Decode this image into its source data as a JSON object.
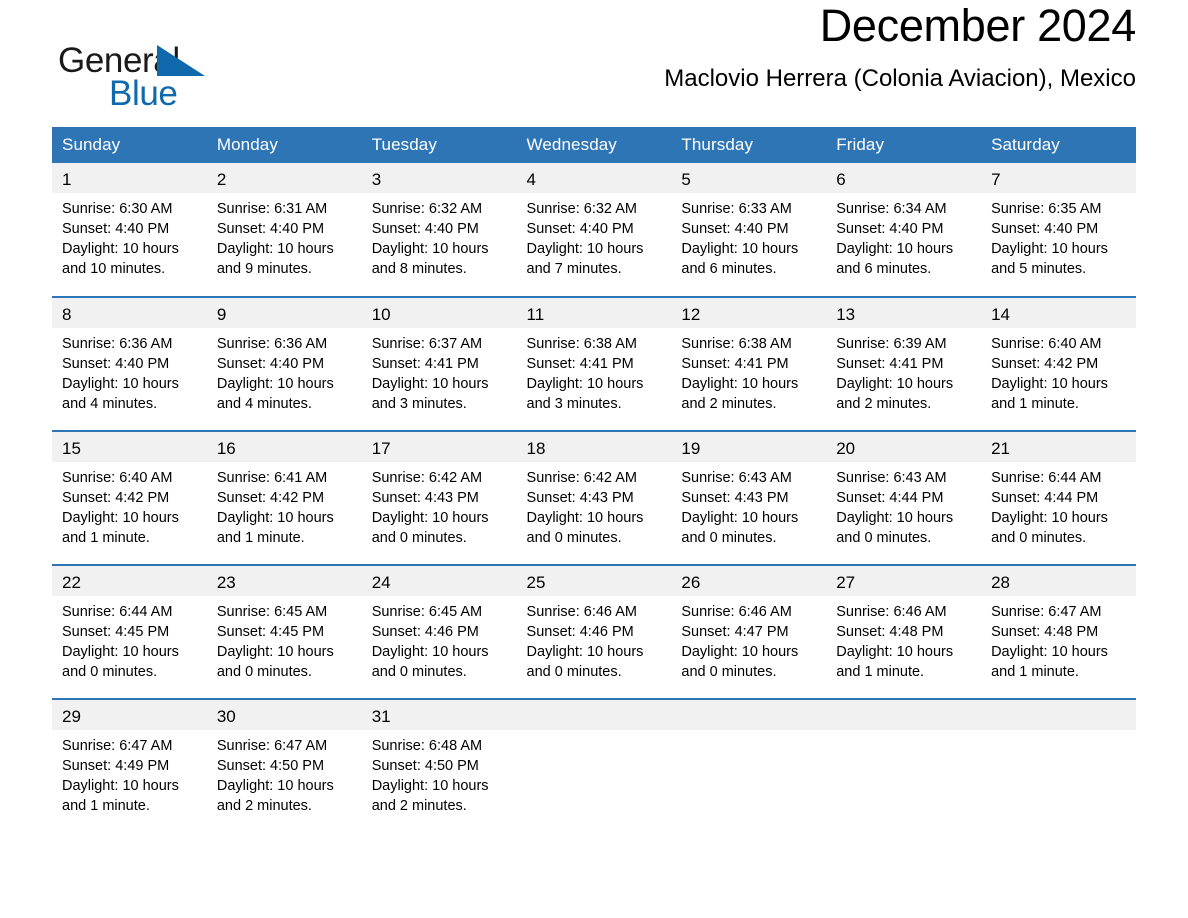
{
  "brand": {
    "name_part1": "General",
    "name_part2": "Blue",
    "triangle_color": "#1069ad",
    "icon": "brand-triangle-icon"
  },
  "header": {
    "month_title": "December 2024",
    "location": "Maclovio Herrera (Colonia Aviacion), Mexico"
  },
  "theme": {
    "header_blue": "#2e75b6",
    "daynum_band_gray": "#f1f1f1",
    "row_separator_blue": "#2e75b6",
    "text_black": "#000000"
  },
  "weekday_headers": [
    "Sunday",
    "Monday",
    "Tuesday",
    "Wednesday",
    "Thursday",
    "Friday",
    "Saturday"
  ],
  "weeks": [
    [
      {
        "day": "1",
        "sunrise": "Sunrise: 6:30 AM",
        "sunset": "Sunset: 4:40 PM",
        "daylight_l1": "Daylight: 10 hours",
        "daylight_l2": "and 10 minutes."
      },
      {
        "day": "2",
        "sunrise": "Sunrise: 6:31 AM",
        "sunset": "Sunset: 4:40 PM",
        "daylight_l1": "Daylight: 10 hours",
        "daylight_l2": "and 9 minutes."
      },
      {
        "day": "3",
        "sunrise": "Sunrise: 6:32 AM",
        "sunset": "Sunset: 4:40 PM",
        "daylight_l1": "Daylight: 10 hours",
        "daylight_l2": "and 8 minutes."
      },
      {
        "day": "4",
        "sunrise": "Sunrise: 6:32 AM",
        "sunset": "Sunset: 4:40 PM",
        "daylight_l1": "Daylight: 10 hours",
        "daylight_l2": "and 7 minutes."
      },
      {
        "day": "5",
        "sunrise": "Sunrise: 6:33 AM",
        "sunset": "Sunset: 4:40 PM",
        "daylight_l1": "Daylight: 10 hours",
        "daylight_l2": "and 6 minutes."
      },
      {
        "day": "6",
        "sunrise": "Sunrise: 6:34 AM",
        "sunset": "Sunset: 4:40 PM",
        "daylight_l1": "Daylight: 10 hours",
        "daylight_l2": "and 6 minutes."
      },
      {
        "day": "7",
        "sunrise": "Sunrise: 6:35 AM",
        "sunset": "Sunset: 4:40 PM",
        "daylight_l1": "Daylight: 10 hours",
        "daylight_l2": "and 5 minutes."
      }
    ],
    [
      {
        "day": "8",
        "sunrise": "Sunrise: 6:36 AM",
        "sunset": "Sunset: 4:40 PM",
        "daylight_l1": "Daylight: 10 hours",
        "daylight_l2": "and 4 minutes."
      },
      {
        "day": "9",
        "sunrise": "Sunrise: 6:36 AM",
        "sunset": "Sunset: 4:40 PM",
        "daylight_l1": "Daylight: 10 hours",
        "daylight_l2": "and 4 minutes."
      },
      {
        "day": "10",
        "sunrise": "Sunrise: 6:37 AM",
        "sunset": "Sunset: 4:41 PM",
        "daylight_l1": "Daylight: 10 hours",
        "daylight_l2": "and 3 minutes."
      },
      {
        "day": "11",
        "sunrise": "Sunrise: 6:38 AM",
        "sunset": "Sunset: 4:41 PM",
        "daylight_l1": "Daylight: 10 hours",
        "daylight_l2": "and 3 minutes."
      },
      {
        "day": "12",
        "sunrise": "Sunrise: 6:38 AM",
        "sunset": "Sunset: 4:41 PM",
        "daylight_l1": "Daylight: 10 hours",
        "daylight_l2": "and 2 minutes."
      },
      {
        "day": "13",
        "sunrise": "Sunrise: 6:39 AM",
        "sunset": "Sunset: 4:41 PM",
        "daylight_l1": "Daylight: 10 hours",
        "daylight_l2": "and 2 minutes."
      },
      {
        "day": "14",
        "sunrise": "Sunrise: 6:40 AM",
        "sunset": "Sunset: 4:42 PM",
        "daylight_l1": "Daylight: 10 hours",
        "daylight_l2": "and 1 minute."
      }
    ],
    [
      {
        "day": "15",
        "sunrise": "Sunrise: 6:40 AM",
        "sunset": "Sunset: 4:42 PM",
        "daylight_l1": "Daylight: 10 hours",
        "daylight_l2": "and 1 minute."
      },
      {
        "day": "16",
        "sunrise": "Sunrise: 6:41 AM",
        "sunset": "Sunset: 4:42 PM",
        "daylight_l1": "Daylight: 10 hours",
        "daylight_l2": "and 1 minute."
      },
      {
        "day": "17",
        "sunrise": "Sunrise: 6:42 AM",
        "sunset": "Sunset: 4:43 PM",
        "daylight_l1": "Daylight: 10 hours",
        "daylight_l2": "and 0 minutes."
      },
      {
        "day": "18",
        "sunrise": "Sunrise: 6:42 AM",
        "sunset": "Sunset: 4:43 PM",
        "daylight_l1": "Daylight: 10 hours",
        "daylight_l2": "and 0 minutes."
      },
      {
        "day": "19",
        "sunrise": "Sunrise: 6:43 AM",
        "sunset": "Sunset: 4:43 PM",
        "daylight_l1": "Daylight: 10 hours",
        "daylight_l2": "and 0 minutes."
      },
      {
        "day": "20",
        "sunrise": "Sunrise: 6:43 AM",
        "sunset": "Sunset: 4:44 PM",
        "daylight_l1": "Daylight: 10 hours",
        "daylight_l2": "and 0 minutes."
      },
      {
        "day": "21",
        "sunrise": "Sunrise: 6:44 AM",
        "sunset": "Sunset: 4:44 PM",
        "daylight_l1": "Daylight: 10 hours",
        "daylight_l2": "and 0 minutes."
      }
    ],
    [
      {
        "day": "22",
        "sunrise": "Sunrise: 6:44 AM",
        "sunset": "Sunset: 4:45 PM",
        "daylight_l1": "Daylight: 10 hours",
        "daylight_l2": "and 0 minutes."
      },
      {
        "day": "23",
        "sunrise": "Sunrise: 6:45 AM",
        "sunset": "Sunset: 4:45 PM",
        "daylight_l1": "Daylight: 10 hours",
        "daylight_l2": "and 0 minutes."
      },
      {
        "day": "24",
        "sunrise": "Sunrise: 6:45 AM",
        "sunset": "Sunset: 4:46 PM",
        "daylight_l1": "Daylight: 10 hours",
        "daylight_l2": "and 0 minutes."
      },
      {
        "day": "25",
        "sunrise": "Sunrise: 6:46 AM",
        "sunset": "Sunset: 4:46 PM",
        "daylight_l1": "Daylight: 10 hours",
        "daylight_l2": "and 0 minutes."
      },
      {
        "day": "26",
        "sunrise": "Sunrise: 6:46 AM",
        "sunset": "Sunset: 4:47 PM",
        "daylight_l1": "Daylight: 10 hours",
        "daylight_l2": "and 0 minutes."
      },
      {
        "day": "27",
        "sunrise": "Sunrise: 6:46 AM",
        "sunset": "Sunset: 4:48 PM",
        "daylight_l1": "Daylight: 10 hours",
        "daylight_l2": "and 1 minute."
      },
      {
        "day": "28",
        "sunrise": "Sunrise: 6:47 AM",
        "sunset": "Sunset: 4:48 PM",
        "daylight_l1": "Daylight: 10 hours",
        "daylight_l2": "and 1 minute."
      }
    ],
    [
      {
        "day": "29",
        "sunrise": "Sunrise: 6:47 AM",
        "sunset": "Sunset: 4:49 PM",
        "daylight_l1": "Daylight: 10 hours",
        "daylight_l2": "and 1 minute."
      },
      {
        "day": "30",
        "sunrise": "Sunrise: 6:47 AM",
        "sunset": "Sunset: 4:50 PM",
        "daylight_l1": "Daylight: 10 hours",
        "daylight_l2": "and 2 minutes."
      },
      {
        "day": "31",
        "sunrise": "Sunrise: 6:48 AM",
        "sunset": "Sunset: 4:50 PM",
        "daylight_l1": "Daylight: 10 hours",
        "daylight_l2": "and 2 minutes."
      },
      null,
      null,
      null,
      null
    ]
  ]
}
